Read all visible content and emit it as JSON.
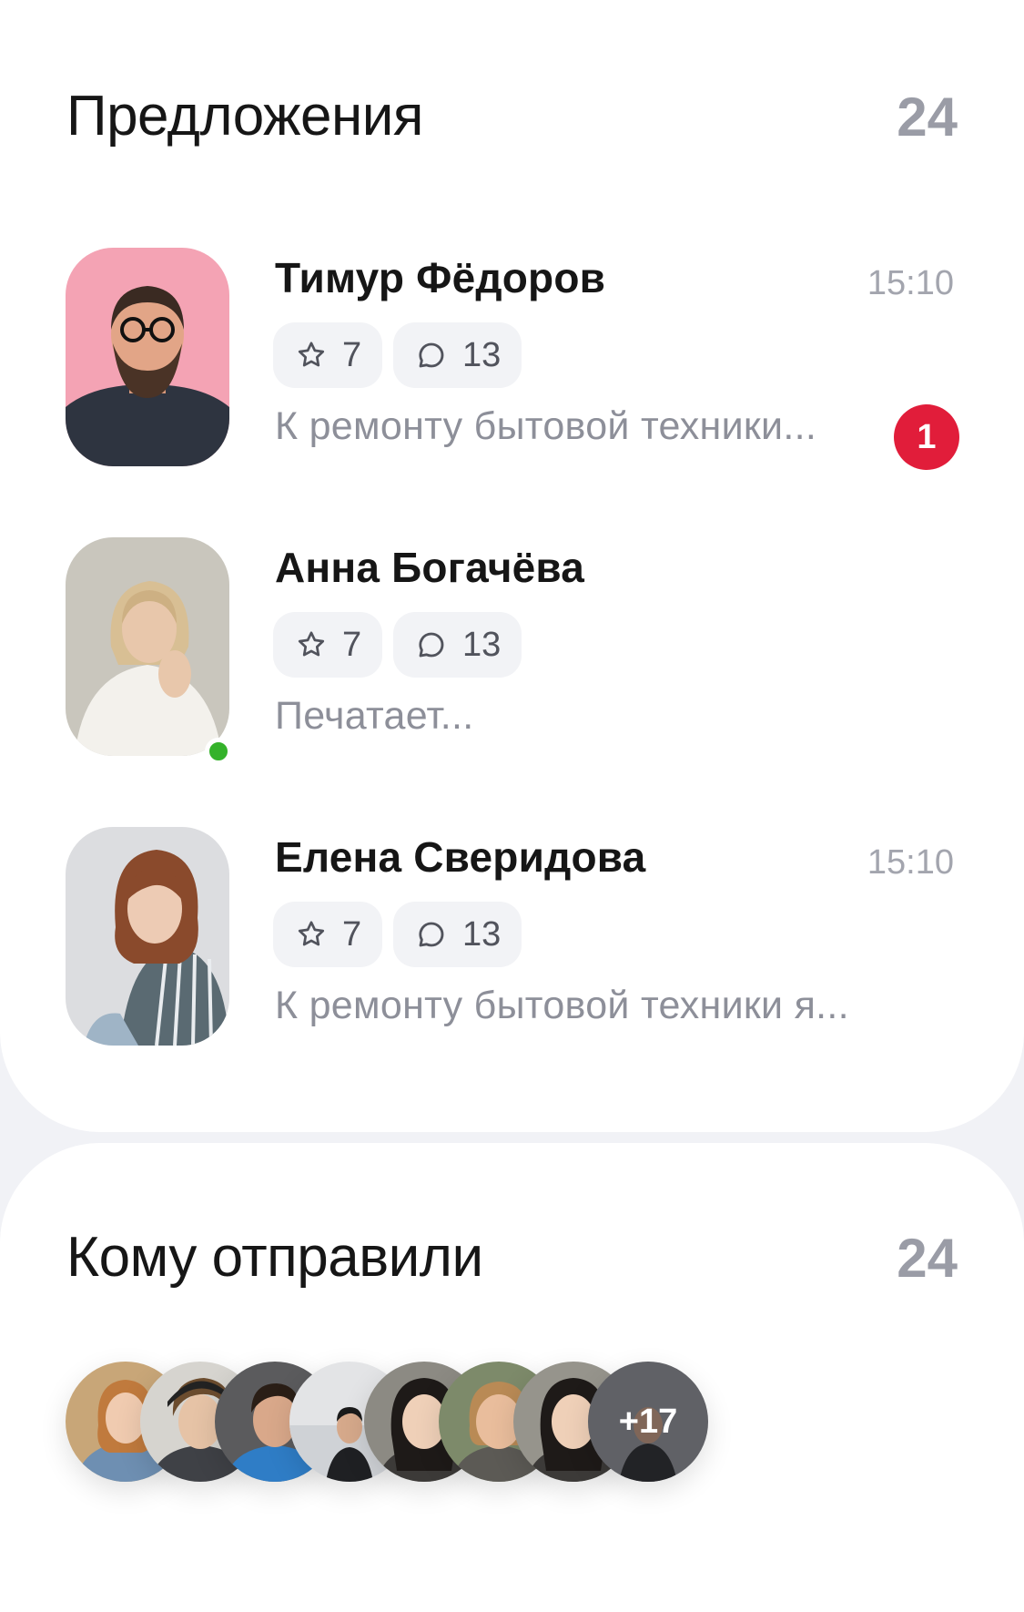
{
  "offers": {
    "title": "Предложения",
    "count": "24",
    "items": [
      {
        "name": "Тимур Фёдоров",
        "time": "15:10",
        "rating": "7",
        "comments": "13",
        "preview": "К ремонту бытовой техники...",
        "unread": "1",
        "online": false
      },
      {
        "name": "Анна Богачёва",
        "time": "",
        "rating": "7",
        "comments": "13",
        "preview": "Печатает...",
        "unread": "",
        "online": true
      },
      {
        "name": "Елена Сверидова",
        "time": "15:10",
        "rating": "7",
        "comments": "13",
        "preview": "К ремонту бытовой техники я...",
        "unread": "",
        "online": false
      }
    ]
  },
  "sent": {
    "title": "Кому отправили",
    "count": "24",
    "more_label": "+17"
  },
  "icons": {
    "rating": "star-outline-icon",
    "comments": "chat-bubble-icon"
  },
  "colors": {
    "accent_red": "#e11d3a",
    "online_green": "#34b22a",
    "muted_text": "#8d8f99",
    "chip_bg": "#f2f3f6"
  }
}
